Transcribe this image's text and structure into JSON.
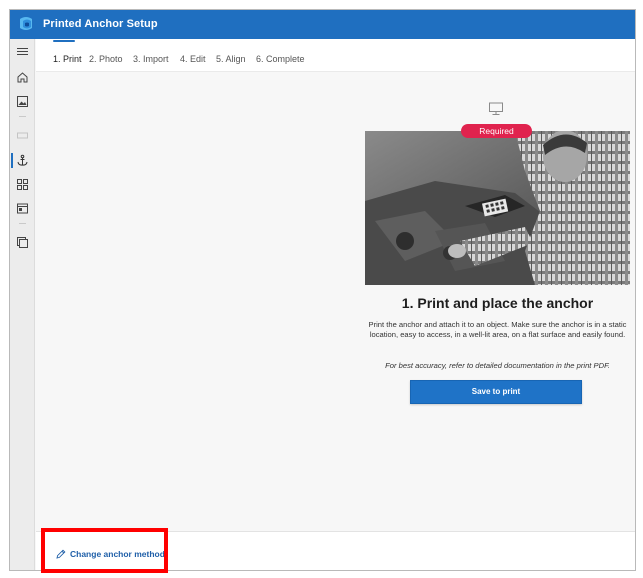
{
  "app": {
    "title": "Printed Anchor Setup"
  },
  "rail": {
    "items": [
      {
        "icon": "hamburger-menu-icon"
      },
      {
        "icon": "home-icon"
      },
      {
        "icon": "image-icon"
      },
      {
        "icon": "dimmed-item-icon"
      },
      {
        "icon": "anchor-icon",
        "active": true
      },
      {
        "icon": "grid-icon"
      },
      {
        "icon": "panel-icon"
      },
      {
        "icon": "layers-icon"
      }
    ]
  },
  "tabs": [
    {
      "label": "1. Print",
      "active": true
    },
    {
      "label": "2. Photo"
    },
    {
      "label": "3. Import"
    },
    {
      "label": "4. Edit"
    },
    {
      "label": "5. Align"
    },
    {
      "label": "6. Complete"
    }
  ],
  "step": {
    "badge": "Required",
    "heading": "1. Print and place the anchor",
    "description": "Print the anchor and attach it to an object. Make sure the anchor is in a static location, easy to access, in a well-lit area, on a flat surface and easily found.",
    "note": "For best accuracy, refer to detailed documentation in the print PDF.",
    "save_button": "Save to print"
  },
  "footer": {
    "change_link": "Change anchor method"
  },
  "colors": {
    "titlebar": "#1f6fc0",
    "accent": "#1f73c7",
    "badge": "#e0234e",
    "highlight": "#ff0000"
  }
}
